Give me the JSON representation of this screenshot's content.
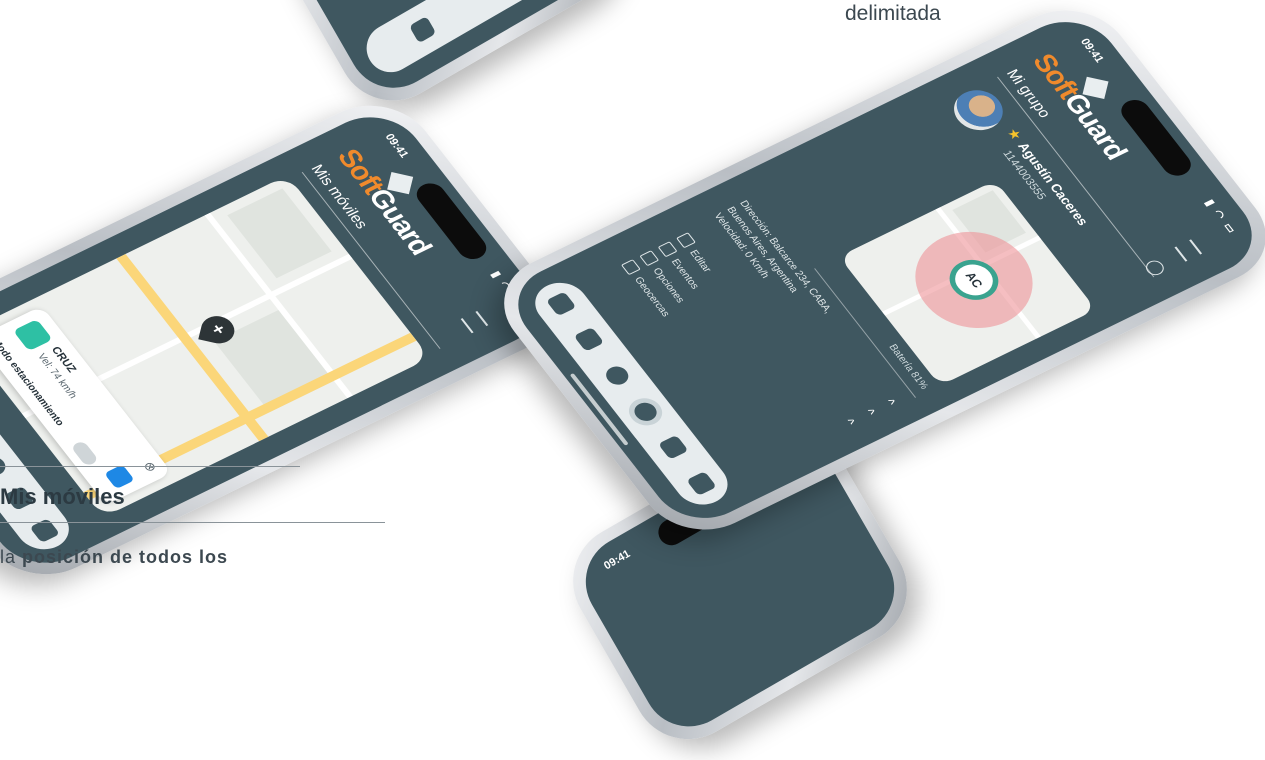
{
  "caption_top": "delimitada",
  "left_section": {
    "heading": "Mis móviles",
    "body_prefix": "la ",
    "body_bold": "posición de todos los"
  },
  "phone_left": {
    "time": "09:41",
    "brand_soft": "Soft",
    "brand_guard": "Guard",
    "title": "Mis móviles",
    "vehicle_name": "CRUZ",
    "vehicle_speed": "Vel: 74 km/h",
    "parking_mode": "Modo estacionamiento",
    "close_symbol": "⊗"
  },
  "phone_right": {
    "time": "09:41",
    "brand_soft": "Soft",
    "brand_guard": "Guard",
    "title": "Mi grupo",
    "contact_name": "Agustín Caceres",
    "contact_phone": "1144003555",
    "map_pin_label": "AC",
    "battery": "Batería 81%",
    "address_line1": "Dirección: Balcarce 234, CABA,",
    "address_line2": "Buenos Aires, Argentina",
    "address_line3": "Velocidad: 0 Km/h",
    "actions": [
      "Editar",
      "Eventos",
      "Opciones",
      "Geocercas"
    ],
    "chevron": "^"
  },
  "phone_bottom": {
    "time": "09:41"
  },
  "colors": {
    "screen": "#3f5760",
    "brand_orange": "#f08a2c",
    "accent_teal": "#2ec0a4",
    "halo_pink": "#ee9298"
  }
}
